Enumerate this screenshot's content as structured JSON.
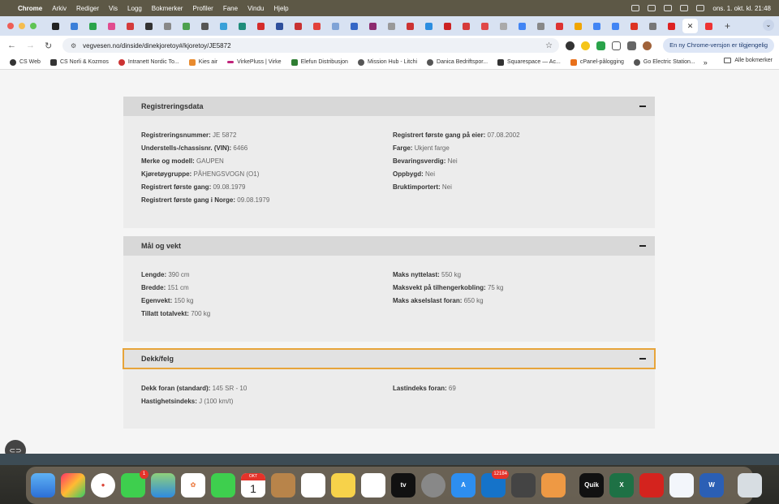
{
  "menubar": {
    "app_name": "Chrome",
    "items": [
      "Arkiv",
      "Rediger",
      "Vis",
      "Logg",
      "Bokmerker",
      "Profiler",
      "Fane",
      "Vindu",
      "Hjelp"
    ],
    "clock": "ons. 1. okt. kl. 21:48"
  },
  "toolbar": {
    "url": "vegvesen.no/dinside/dinekjoretoy#/kjoretoy/JE5872",
    "update_button": "En ny Chrome-versjon er tilgjengelig"
  },
  "bookmarks": {
    "items": [
      "CS Web",
      "CS Norli & Kozmos",
      "Intranett Nordic To...",
      "Kies air",
      "VirkePluss | Virke",
      "Elefun Distribusjon",
      "Mission Hub - Litchi",
      "Danica Bedriftspor...",
      "Squarespace — Ac...",
      "cPanel-pålogging",
      "Go Electric Station..."
    ],
    "more": "»",
    "all_bookmarks": "Alle bokmerker"
  },
  "sections": {
    "registrering": {
      "title": "Registreringsdata",
      "left": [
        {
          "label": "Registreringsnummer:",
          "value": "JE 5872"
        },
        {
          "label": "Understells-/chassisnr. (VIN):",
          "value": "6466"
        },
        {
          "label": "Merke og modell:",
          "value": "GAUPEN"
        },
        {
          "label": "Kjøretøygruppe:",
          "value": "PÅHENGSVOGN (O1)"
        },
        {
          "label": "Registrert første gang:",
          "value": "09.08.1979"
        },
        {
          "label": "Registrert første gang i Norge:",
          "value": "09.08.1979"
        }
      ],
      "right": [
        {
          "label": "Registrert første gang på eier:",
          "value": "07.08.2002"
        },
        {
          "label": "Farge:",
          "value": "Ukjent farge"
        },
        {
          "label": "Bevaringsverdig:",
          "value": "Nei"
        },
        {
          "label": "Oppbygd:",
          "value": "Nei"
        },
        {
          "label": "Bruktimportert:",
          "value": "Nei"
        }
      ]
    },
    "maal": {
      "title": "Mål og vekt",
      "left": [
        {
          "label": "Lengde:",
          "value": "390 cm"
        },
        {
          "label": "Bredde:",
          "value": "151 cm"
        },
        {
          "label": "Egenvekt:",
          "value": "150 kg"
        },
        {
          "label": "Tillatt totalvekt:",
          "value": "700 kg"
        }
      ],
      "right": [
        {
          "label": "Maks nyttelast:",
          "value": "550 kg"
        },
        {
          "label": "Maksvekt på tilhengerkobling:",
          "value": "75 kg"
        },
        {
          "label": "Maks akselslast foran:",
          "value": "650 kg"
        }
      ]
    },
    "dekk": {
      "title": "Dekk/felg",
      "left": [
        {
          "label": "Dekk foran (standard):",
          "value": "145 SR - 10"
        },
        {
          "label": "Hastighetsindeks:",
          "value": "J (100 km/t)"
        }
      ],
      "right": [
        {
          "label": "Lastindeks foran:",
          "value": "69"
        }
      ]
    }
  },
  "dock": {
    "calendar_month": "OKT",
    "calendar_day": "1",
    "messages_badge": "1",
    "outlook_badge": "12184",
    "quik_label": "Quik"
  }
}
